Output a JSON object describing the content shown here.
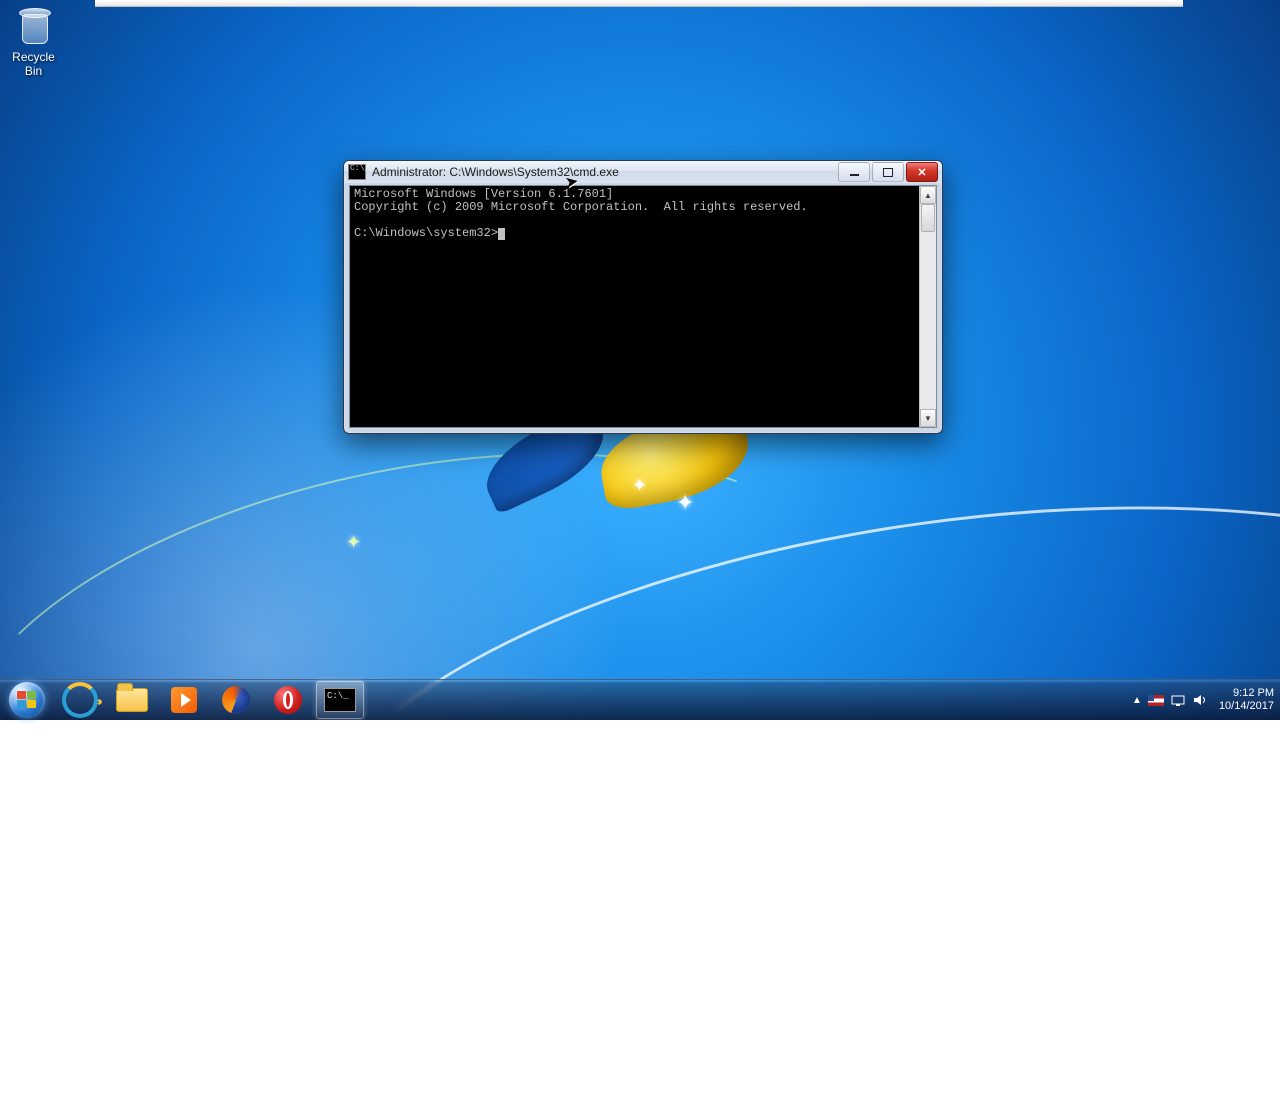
{
  "desktop": {
    "recycle_bin_label": "Recycle Bin"
  },
  "cmd_window": {
    "title": "Administrator: C:\\Windows\\System32\\cmd.exe",
    "line1": "Microsoft Windows [Version 6.1.7601]",
    "line2": "Copyright (c) 2009 Microsoft Corporation.  All rights reserved.",
    "prompt": "C:\\Windows\\system32>"
  },
  "taskbar": {
    "pinned": {
      "ie": "Internet Explorer",
      "explorer": "Windows Explorer",
      "wmp": "Windows Media Player",
      "firefox": "Firefox",
      "opera": "Opera",
      "cmd": "Command Prompt"
    }
  },
  "systray": {
    "time": "9:12 PM",
    "date": "10/14/2017"
  }
}
